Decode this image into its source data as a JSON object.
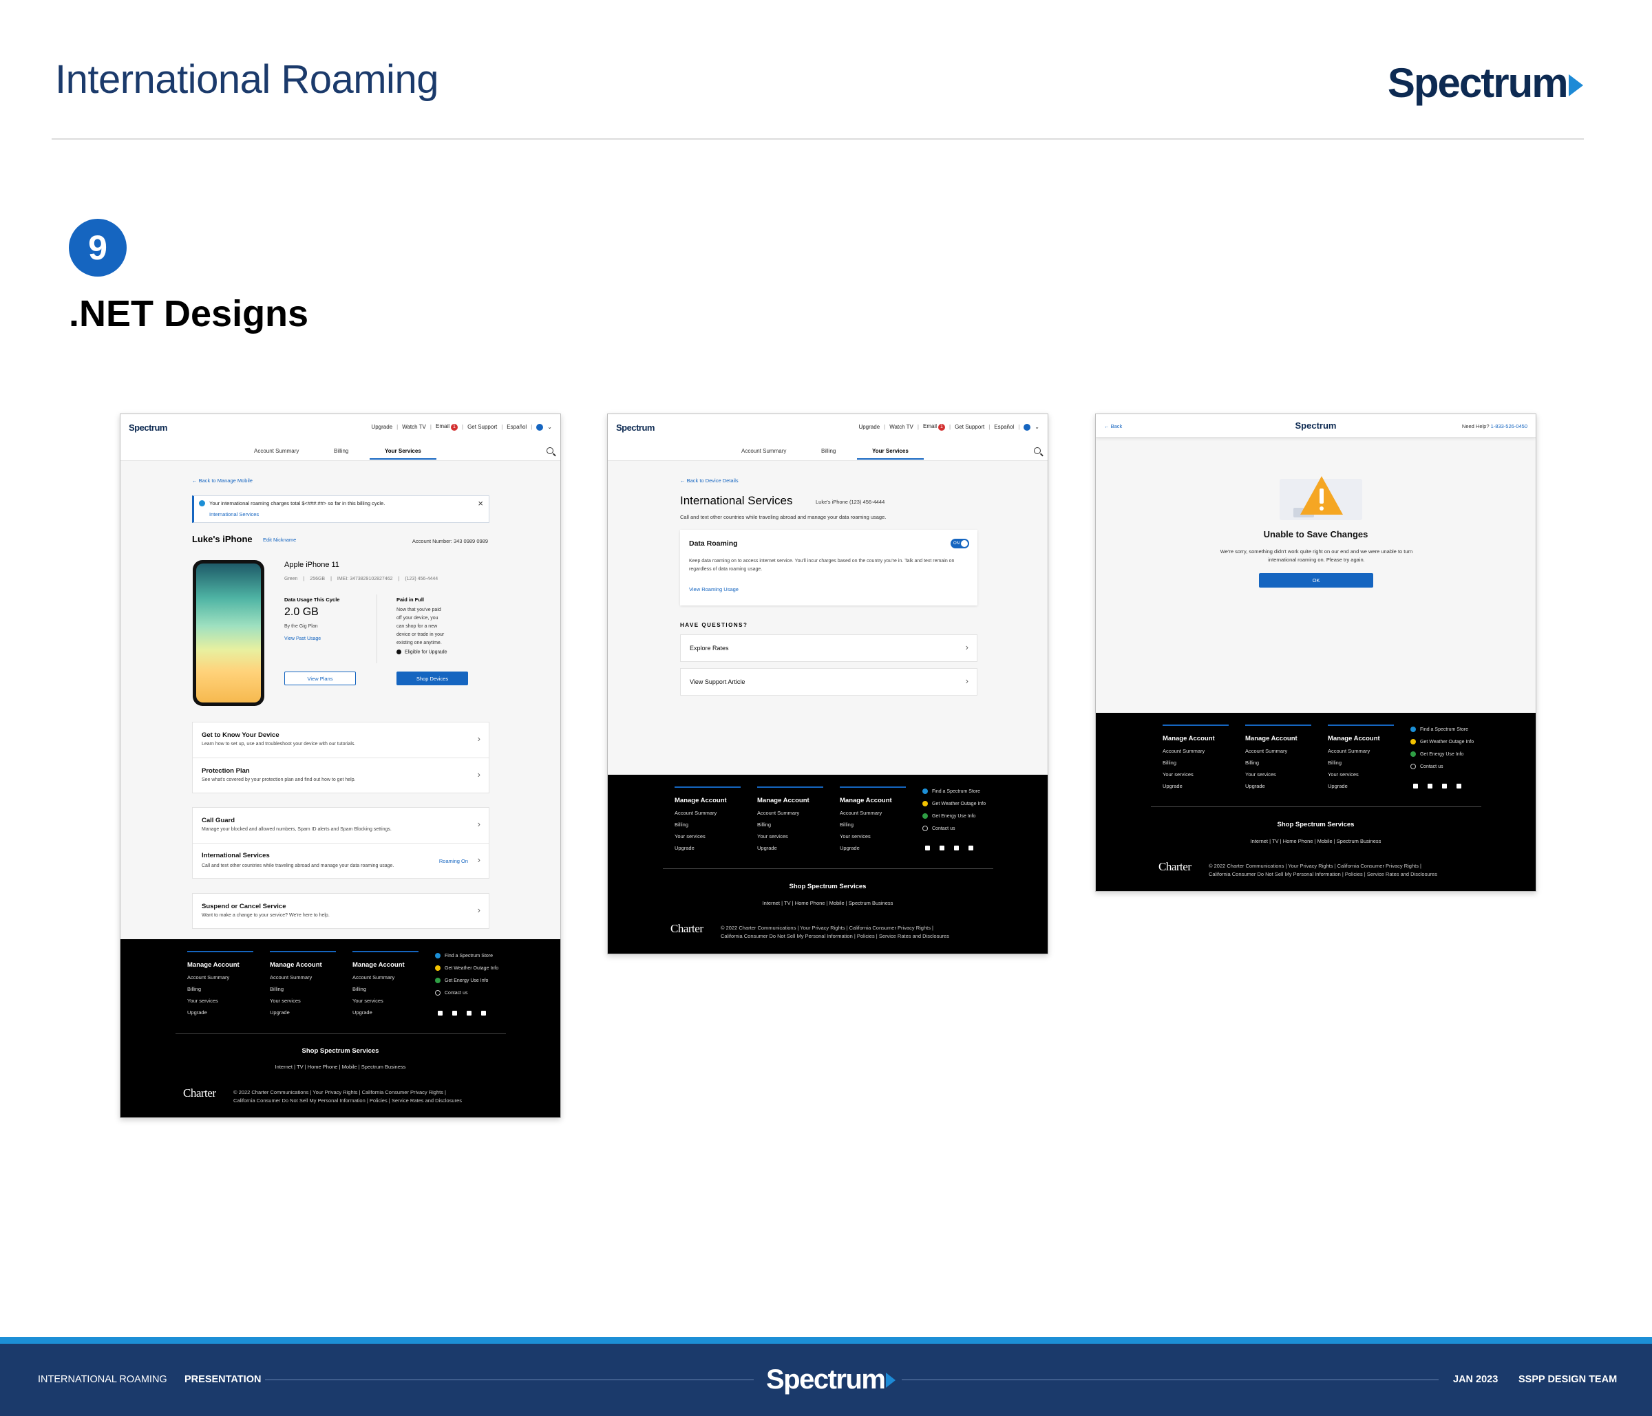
{
  "slide": {
    "title": "International Roaming",
    "brand": "Spectrum",
    "step_number": "9",
    "section_title": ".NET Designs"
  },
  "colors": {
    "brand_navy": "#1b3a6b",
    "accent_blue": "#1565c0",
    "stripe_blue": "#1c8fd6"
  },
  "header": {
    "logo": "Spectrum",
    "utility": [
      "Upgrade",
      "Watch TV",
      "Email",
      "Get Support",
      "Español"
    ],
    "email_badge": "1",
    "tabs": [
      "Account Summary",
      "Billing",
      "Your Services"
    ]
  },
  "screen1": {
    "back": "Back to Manage Mobile",
    "alert_text": "Your international roaming charges total $<###.##> so far in this billing cycle.",
    "alert_link": "International Services",
    "device_title": "Luke's iPhone",
    "edit_nickname": "Edit Nickname",
    "account_number": "Account Number: 343 0989 0989",
    "model": "Apple iPhone 11",
    "specs": [
      "Green",
      "256GB",
      "IMEI: 347382910282746​2",
      "(123) 456-4444"
    ],
    "usage_label": "Data Usage This Cycle",
    "usage_value": "2.0 GB",
    "plan": "By the Gig Plan",
    "view_past": "View Past Usage",
    "paid_title": "Paid in Full",
    "paid_text": "Now that you've paid off your device, you can shop for a new device or trade in your existing one anytime.",
    "eligible": "Eligible for Upgrade",
    "btn_plans": "View Plans",
    "btn_shop": "Shop Devices",
    "rows": [
      {
        "title": "Get to Know Your Device",
        "sub": "Learn how to set up, use and troubleshoot your device with our tutorials.",
        "status": ""
      },
      {
        "title": "Protection Plan",
        "sub": "See what's covered by your protection plan and find out how to get help.",
        "status": ""
      },
      {
        "title": "Call Guard",
        "sub": "Manage your blocked and allowed numbers, Spam ID alerts and Spam Blocking settings.",
        "status": ""
      },
      {
        "title": "International Services",
        "sub": "Call and text other countries while traveling abroad and manage your data roaming usage.",
        "status": "Roaming On"
      },
      {
        "title": "Suspend or Cancel Service",
        "sub": "Want to make a change to your service? We're here to help.",
        "status": ""
      }
    ]
  },
  "screen2": {
    "back": "Back to Device Details",
    "title": "International Services",
    "device": "Luke's iPhone (123) 456-4444",
    "intro": "Call and text other countries while traveling abroad and manage your data roaming usage.",
    "card_title": "Data Roaming",
    "toggle": "ON",
    "card_text": "Keep data roaming on to access internet service. You'll incur charges based on the country you're in. Talk and text remain on regardless of data roaming usage.",
    "card_link": "View Roaming Usage",
    "questions": "HAVE QUESTIONS?",
    "rows": [
      "Explore Rates",
      "View Support Article"
    ]
  },
  "screen3": {
    "back": "Back",
    "logo": "Spectrum",
    "help_label": "Need Help?",
    "help_phone": "1-833-526-0450",
    "title": "Unable to Save Changes",
    "text": "We're sorry, something didn't work quite right on our end and we were unable to turn international roaming on. Please try again.",
    "ok": "OK"
  },
  "footer": {
    "col_title": "Manage Account",
    "col_links": [
      "Account Summary",
      "Billing",
      "Your services",
      "Upgrade"
    ],
    "side_links": [
      "Find a Spectrum Store",
      "Get Weather Outage Info",
      "Get Energy Use Info",
      "Contact us"
    ],
    "shop_title": "Shop Spectrum Services",
    "shop_links": "Internet   |   TV   |   Home Phone   |   Mobile   |   Spectrum Business",
    "charter": "Charter",
    "legal1": "© 2022 Charter Communications   |   Your Privacy Rights   |   California Consumer Privacy Rights   |",
    "legal2": "California Consumer Do Not Sell My Personal Information   |   Policies   |   Service Rates and Disclosures"
  },
  "bottom_bar": {
    "project": "INTERNATIONAL ROAMING",
    "doc_type": "PRESENTATION",
    "logo": "Spectrum",
    "date": "JAN 2023",
    "team": "SSPP DESIGN TEAM"
  }
}
